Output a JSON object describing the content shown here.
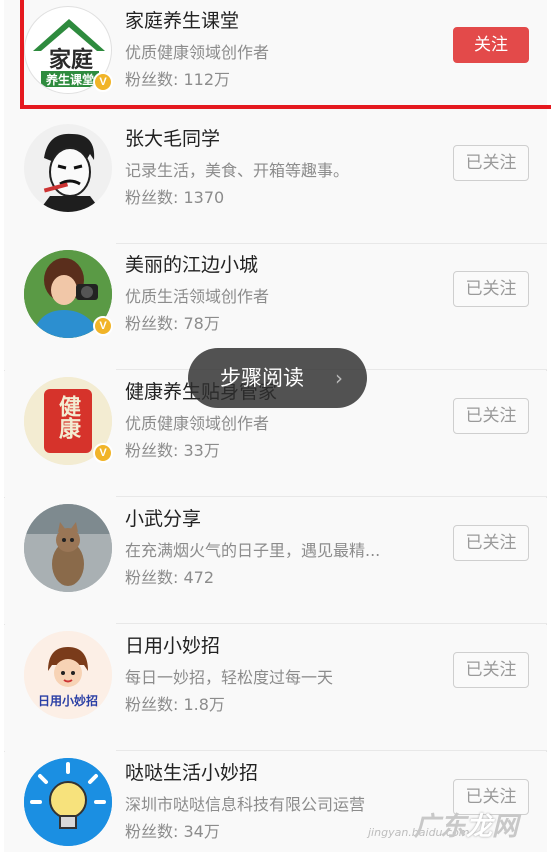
{
  "follow_list": [
    {
      "name": "家庭养生课堂",
      "desc": "优质健康领域创作者",
      "fans": "粉丝数: 112万",
      "button": "关注",
      "avatar_icon": "house-logo-icon",
      "verified": true,
      "followed": false
    },
    {
      "name": "张大毛同学",
      "desc": "记录生活，美食、开箱等趣事。",
      "fans": "粉丝数: 1370",
      "button": "已关注",
      "avatar_icon": "cartoon-man-icon",
      "verified": false,
      "followed": true
    },
    {
      "name": "美丽的江边小城",
      "desc": "优质生活领域创作者",
      "fans": "粉丝数: 78万",
      "button": "已关注",
      "avatar_icon": "photographer-icon",
      "verified": true,
      "followed": true
    },
    {
      "name": "健康养生贴身管家",
      "desc": "优质健康领域创作者",
      "fans": "粉丝数: 33万",
      "button": "已关注",
      "avatar_icon": "health-seal-icon",
      "verified": true,
      "followed": true
    },
    {
      "name": "小武分享",
      "desc": "在充满烟火气的日子里，遇见最精...",
      "fans": "粉丝数: 472",
      "button": "已关注",
      "avatar_icon": "cat-photo-icon",
      "verified": false,
      "followed": true
    },
    {
      "name": "日用小妙招",
      "desc": "每日一妙招，轻松度过每一天",
      "fans": "粉丝数: 1.8万",
      "button": "已关注",
      "avatar_icon": "cartoon-girl-icon",
      "verified": false,
      "followed": true
    },
    {
      "name": "哒哒生活小妙招",
      "desc": "深圳市哒哒信息科技有限公司运营",
      "fans": "粉丝数: 34万",
      "button": "已关注",
      "avatar_icon": "lightbulb-icon",
      "verified": false,
      "followed": true
    }
  ],
  "avatar_text": {
    "logo_line1": "家庭",
    "logo_line2": "养生课堂",
    "seal": "健康",
    "cartoon": "日用小妙招",
    "verified_mark": "V"
  },
  "toast": {
    "label": "步骤阅读",
    "chevron": "›"
  },
  "watermark": {
    "text_a": "广东",
    "text_b": "龙",
    "text_c": "网",
    "sub": "jingyan.baidu.com"
  },
  "colors": {
    "follow_active": "#e34a4a",
    "highlight_border": "#e5191f",
    "verified": "#f1b428"
  }
}
